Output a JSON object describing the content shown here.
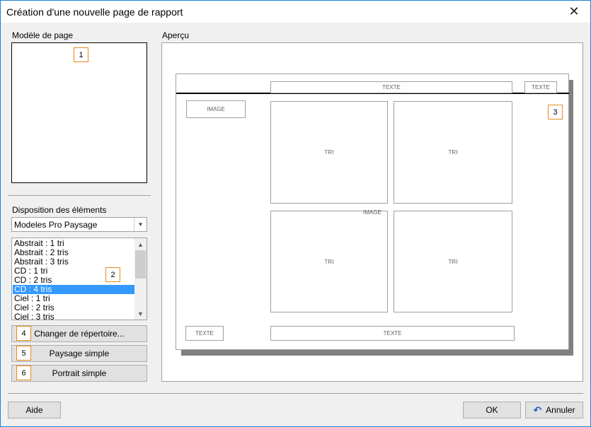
{
  "window": {
    "title": "Création d'une nouvelle page de rapport",
    "close_label": "✕"
  },
  "template": {
    "label": "Modèle de page",
    "badge": "1"
  },
  "preview": {
    "label": "Aperçu",
    "badge": "3",
    "header_text_wide": "TEXTE",
    "header_text_small": "TEXTE",
    "image_left": "IMAGE",
    "image_floating": "IMAGE",
    "tri_labels": [
      "TRI",
      "TRI",
      "TRI",
      "TRI"
    ],
    "footer_text_small": "TEXTE",
    "footer_text_wide": "TEXTE"
  },
  "layout": {
    "label": "Disposition des éléments",
    "combo_value": "Modeles Pro Paysage",
    "badge": "2",
    "items": [
      "Abstrait : 1 tri",
      "Abstrait : 2 tris",
      "Abstrait : 3 tris",
      "CD : 1 tri",
      "CD : 2 tris",
      "CD : 4 tris",
      "Ciel : 1 tri",
      "Ciel : 2 tris",
      "Ciel : 3 tris"
    ],
    "selected_item": "CD : 4 tris"
  },
  "actions": {
    "change_dir": {
      "badge": "4",
      "label": "Changer de répertoire..."
    },
    "landscape": {
      "badge": "5",
      "label": "Paysage simple"
    },
    "portrait": {
      "badge": "6",
      "label": "Portrait simple"
    }
  },
  "footer": {
    "help": "Aide",
    "ok": "OK",
    "cancel": "Annuler"
  },
  "colors": {
    "accent_border": "#1883d7",
    "badge_border": "#e8891c",
    "selection": "#3399ff"
  }
}
